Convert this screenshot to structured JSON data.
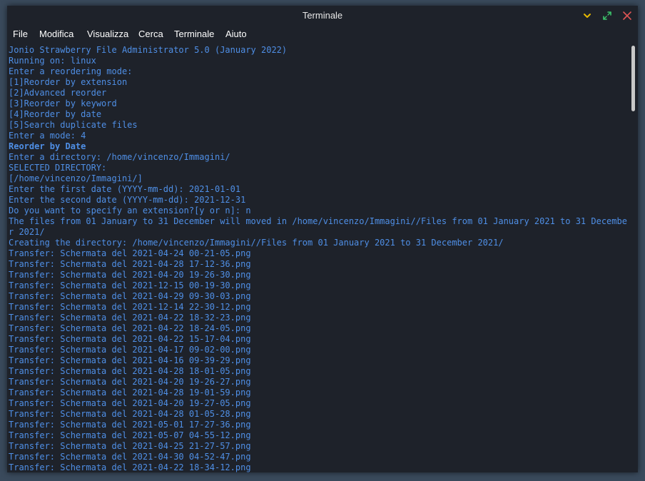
{
  "window": {
    "title": "Terminale"
  },
  "colors": {
    "background": "#1e222a",
    "text": "#4f8fe6",
    "minimize": "#e6b800",
    "maximize": "#3cc46b",
    "close": "#e05555"
  },
  "icons": {
    "minimize": "chevron-down-icon",
    "maximize": "expand-icon",
    "close": "close-icon"
  },
  "menu": {
    "items": [
      "File",
      "Modifica",
      "Visualizza",
      "Cerca",
      "Terminale",
      "Aiuto"
    ]
  },
  "terminal": {
    "lines": [
      {
        "text": "Jonio Strawberry File Administrator 5.0 (January 2022)",
        "bold": false
      },
      {
        "text": "Running on: linux",
        "bold": false
      },
      {
        "text": "Enter a reordering mode:",
        "bold": false
      },
      {
        "text": "[1]Reorder by extension",
        "bold": false
      },
      {
        "text": "[2]Advanced reorder",
        "bold": false
      },
      {
        "text": "[3]Reorder by keyword",
        "bold": false
      },
      {
        "text": "[4]Reorder by date",
        "bold": false
      },
      {
        "text": "[5]Search duplicate files",
        "bold": false
      },
      {
        "text": "Enter a mode: 4",
        "bold": false
      },
      {
        "text": "Reorder by Date",
        "bold": true
      },
      {
        "text": "Enter a directory: /home/vincenzo/Immagini/",
        "bold": false
      },
      {
        "text": "SELECTED DIRECTORY:",
        "bold": false
      },
      {
        "text": "[/home/vincenzo/Immagini/]",
        "bold": false
      },
      {
        "text": "Enter the first date (YYYY-mm-dd): 2021-01-01",
        "bold": false
      },
      {
        "text": "Enter the second date (YYYY-mm-dd): 2021-12-31",
        "bold": false
      },
      {
        "text": "Do you want to specify an extension?[y or n]: n",
        "bold": false
      },
      {
        "text": "The files from 01 January to 31 December will moved in /home/vincenzo/Immagini//Files from 01 January 2021 to 31 December 2021/",
        "bold": false
      },
      {
        "text": "Creating the directory: /home/vincenzo/Immagini//Files from 01 January 2021 to 31 December 2021/",
        "bold": false
      },
      {
        "text": "Transfer: Schermata del 2021-04-24 00-21-05.png",
        "bold": false
      },
      {
        "text": "Transfer: Schermata del 2021-04-28 17-12-36.png",
        "bold": false
      },
      {
        "text": "Transfer: Schermata del 2021-04-20 19-26-30.png",
        "bold": false
      },
      {
        "text": "Transfer: Schermata del 2021-12-15 00-19-30.png",
        "bold": false
      },
      {
        "text": "Transfer: Schermata del 2021-04-29 09-30-03.png",
        "bold": false
      },
      {
        "text": "Transfer: Schermata del 2021-12-14 22-30-12.png",
        "bold": false
      },
      {
        "text": "Transfer: Schermata del 2021-04-22 18-32-23.png",
        "bold": false
      },
      {
        "text": "Transfer: Schermata del 2021-04-22 18-24-05.png",
        "bold": false
      },
      {
        "text": "Transfer: Schermata del 2021-04-22 15-17-04.png",
        "bold": false
      },
      {
        "text": "Transfer: Schermata del 2021-04-17 09-02-00.png",
        "bold": false
      },
      {
        "text": "Transfer: Schermata del 2021-04-16 09-39-29.png",
        "bold": false
      },
      {
        "text": "Transfer: Schermata del 2021-04-28 18-01-05.png",
        "bold": false
      },
      {
        "text": "Transfer: Schermata del 2021-04-20 19-26-27.png",
        "bold": false
      },
      {
        "text": "Transfer: Schermata del 2021-04-28 19-01-59.png",
        "bold": false
      },
      {
        "text": "Transfer: Schermata del 2021-04-20 19-27-05.png",
        "bold": false
      },
      {
        "text": "Transfer: Schermata del 2021-04-28 01-05-28.png",
        "bold": false
      },
      {
        "text": "Transfer: Schermata del 2021-05-01 17-27-36.png",
        "bold": false
      },
      {
        "text": "Transfer: Schermata del 2021-05-07 04-55-12.png",
        "bold": false
      },
      {
        "text": "Transfer: Schermata del 2021-04-25 21-27-57.png",
        "bold": false
      },
      {
        "text": "Transfer: Schermata del 2021-04-30 04-52-47.png",
        "bold": false
      },
      {
        "text": "Transfer: Schermata del 2021-04-22 18-34-12.png",
        "bold": false
      }
    ]
  }
}
